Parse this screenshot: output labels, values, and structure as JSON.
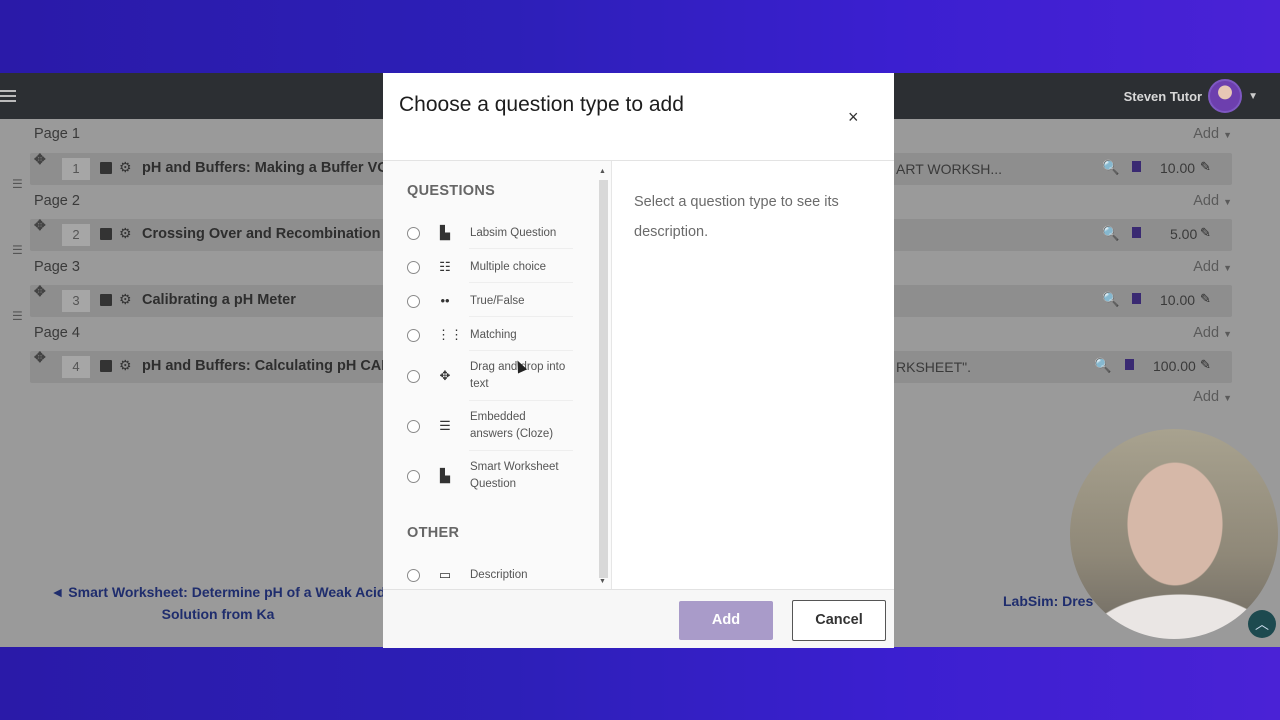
{
  "topbar": {
    "user_name": "Steven Tutor"
  },
  "pages": [
    {
      "label": "Page 1",
      "add": "Add",
      "question": {
        "num": "1",
        "title": "pH and Buffers: Making a Buffer VO",
        "tail": "ART WORKSH...",
        "mark": "10.00"
      }
    },
    {
      "label": "Page 2",
      "add": "Add",
      "question": {
        "num": "2",
        "title": "Crossing Over and Recombination",
        "tail": "",
        "mark": "5.00"
      }
    },
    {
      "label": "Page 3",
      "add": "Add",
      "question": {
        "num": "3",
        "title": "Calibrating a pH Meter",
        "tail": "",
        "mark": "10.00"
      }
    },
    {
      "label": "Page 4",
      "add": "Add",
      "question": {
        "num": "4",
        "title": "pH and Buffers: Calculating pH CAL",
        "tail": "RKSHEET\".",
        "mark": "100.00"
      }
    }
  ],
  "final_add": "Add",
  "nav": {
    "prev_link_line1": "◄ Smart Worksheet: Determine pH of a Weak Acid",
    "prev_link_line2": "Solution from Ka",
    "next_link": "LabSim: Dres"
  },
  "modal": {
    "title": "Choose a question type to add",
    "close": "×",
    "section_questions": "QUESTIONS",
    "section_other": "OTHER",
    "options": [
      {
        "icon": "beaker-icon",
        "label": "Labsim Question"
      },
      {
        "icon": "list-icon",
        "label": "Multiple choice"
      },
      {
        "icon": "dots-icon",
        "label": "True/False"
      },
      {
        "icon": "grid-icon",
        "label": "Matching"
      },
      {
        "icon": "move-icon",
        "label": "Drag and drop into text"
      },
      {
        "icon": "cloze-icon",
        "label": "Embedded answers (Cloze)"
      },
      {
        "icon": "beaker-icon",
        "label": "Smart Worksheet Question"
      }
    ],
    "other_options": [
      {
        "icon": "image-icon",
        "label": "Description"
      }
    ],
    "description_placeholder": "Select a question type to see its description.",
    "add_button": "Add",
    "cancel_button": "Cancel"
  }
}
